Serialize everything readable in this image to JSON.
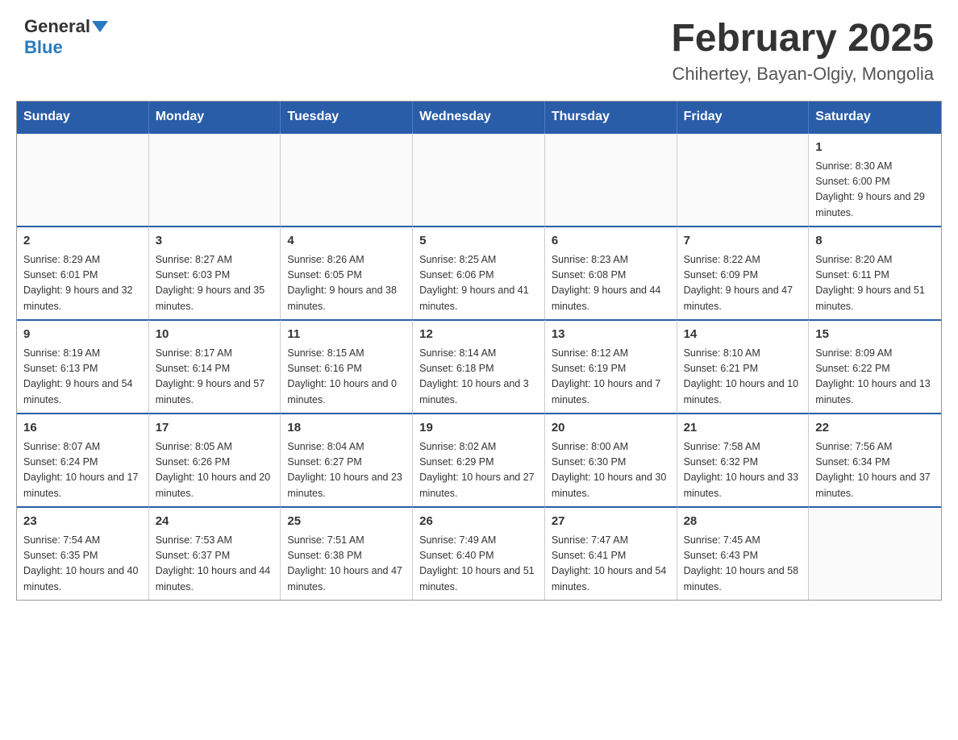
{
  "header": {
    "logo_general": "General",
    "logo_blue": "Blue",
    "title": "February 2025",
    "subtitle": "Chihertey, Bayan-Olgiy, Mongolia"
  },
  "days_of_week": [
    "Sunday",
    "Monday",
    "Tuesday",
    "Wednesday",
    "Thursday",
    "Friday",
    "Saturday"
  ],
  "weeks": [
    [
      {
        "day": "",
        "info": ""
      },
      {
        "day": "",
        "info": ""
      },
      {
        "day": "",
        "info": ""
      },
      {
        "day": "",
        "info": ""
      },
      {
        "day": "",
        "info": ""
      },
      {
        "day": "",
        "info": ""
      },
      {
        "day": "1",
        "info": "Sunrise: 8:30 AM\nSunset: 6:00 PM\nDaylight: 9 hours and 29 minutes."
      }
    ],
    [
      {
        "day": "2",
        "info": "Sunrise: 8:29 AM\nSunset: 6:01 PM\nDaylight: 9 hours and 32 minutes."
      },
      {
        "day": "3",
        "info": "Sunrise: 8:27 AM\nSunset: 6:03 PM\nDaylight: 9 hours and 35 minutes."
      },
      {
        "day": "4",
        "info": "Sunrise: 8:26 AM\nSunset: 6:05 PM\nDaylight: 9 hours and 38 minutes."
      },
      {
        "day": "5",
        "info": "Sunrise: 8:25 AM\nSunset: 6:06 PM\nDaylight: 9 hours and 41 minutes."
      },
      {
        "day": "6",
        "info": "Sunrise: 8:23 AM\nSunset: 6:08 PM\nDaylight: 9 hours and 44 minutes."
      },
      {
        "day": "7",
        "info": "Sunrise: 8:22 AM\nSunset: 6:09 PM\nDaylight: 9 hours and 47 minutes."
      },
      {
        "day": "8",
        "info": "Sunrise: 8:20 AM\nSunset: 6:11 PM\nDaylight: 9 hours and 51 minutes."
      }
    ],
    [
      {
        "day": "9",
        "info": "Sunrise: 8:19 AM\nSunset: 6:13 PM\nDaylight: 9 hours and 54 minutes."
      },
      {
        "day": "10",
        "info": "Sunrise: 8:17 AM\nSunset: 6:14 PM\nDaylight: 9 hours and 57 minutes."
      },
      {
        "day": "11",
        "info": "Sunrise: 8:15 AM\nSunset: 6:16 PM\nDaylight: 10 hours and 0 minutes."
      },
      {
        "day": "12",
        "info": "Sunrise: 8:14 AM\nSunset: 6:18 PM\nDaylight: 10 hours and 3 minutes."
      },
      {
        "day": "13",
        "info": "Sunrise: 8:12 AM\nSunset: 6:19 PM\nDaylight: 10 hours and 7 minutes."
      },
      {
        "day": "14",
        "info": "Sunrise: 8:10 AM\nSunset: 6:21 PM\nDaylight: 10 hours and 10 minutes."
      },
      {
        "day": "15",
        "info": "Sunrise: 8:09 AM\nSunset: 6:22 PM\nDaylight: 10 hours and 13 minutes."
      }
    ],
    [
      {
        "day": "16",
        "info": "Sunrise: 8:07 AM\nSunset: 6:24 PM\nDaylight: 10 hours and 17 minutes."
      },
      {
        "day": "17",
        "info": "Sunrise: 8:05 AM\nSunset: 6:26 PM\nDaylight: 10 hours and 20 minutes."
      },
      {
        "day": "18",
        "info": "Sunrise: 8:04 AM\nSunset: 6:27 PM\nDaylight: 10 hours and 23 minutes."
      },
      {
        "day": "19",
        "info": "Sunrise: 8:02 AM\nSunset: 6:29 PM\nDaylight: 10 hours and 27 minutes."
      },
      {
        "day": "20",
        "info": "Sunrise: 8:00 AM\nSunset: 6:30 PM\nDaylight: 10 hours and 30 minutes."
      },
      {
        "day": "21",
        "info": "Sunrise: 7:58 AM\nSunset: 6:32 PM\nDaylight: 10 hours and 33 minutes."
      },
      {
        "day": "22",
        "info": "Sunrise: 7:56 AM\nSunset: 6:34 PM\nDaylight: 10 hours and 37 minutes."
      }
    ],
    [
      {
        "day": "23",
        "info": "Sunrise: 7:54 AM\nSunset: 6:35 PM\nDaylight: 10 hours and 40 minutes."
      },
      {
        "day": "24",
        "info": "Sunrise: 7:53 AM\nSunset: 6:37 PM\nDaylight: 10 hours and 44 minutes."
      },
      {
        "day": "25",
        "info": "Sunrise: 7:51 AM\nSunset: 6:38 PM\nDaylight: 10 hours and 47 minutes."
      },
      {
        "day": "26",
        "info": "Sunrise: 7:49 AM\nSunset: 6:40 PM\nDaylight: 10 hours and 51 minutes."
      },
      {
        "day": "27",
        "info": "Sunrise: 7:47 AM\nSunset: 6:41 PM\nDaylight: 10 hours and 54 minutes."
      },
      {
        "day": "28",
        "info": "Sunrise: 7:45 AM\nSunset: 6:43 PM\nDaylight: 10 hours and 58 minutes."
      },
      {
        "day": "",
        "info": ""
      }
    ]
  ]
}
